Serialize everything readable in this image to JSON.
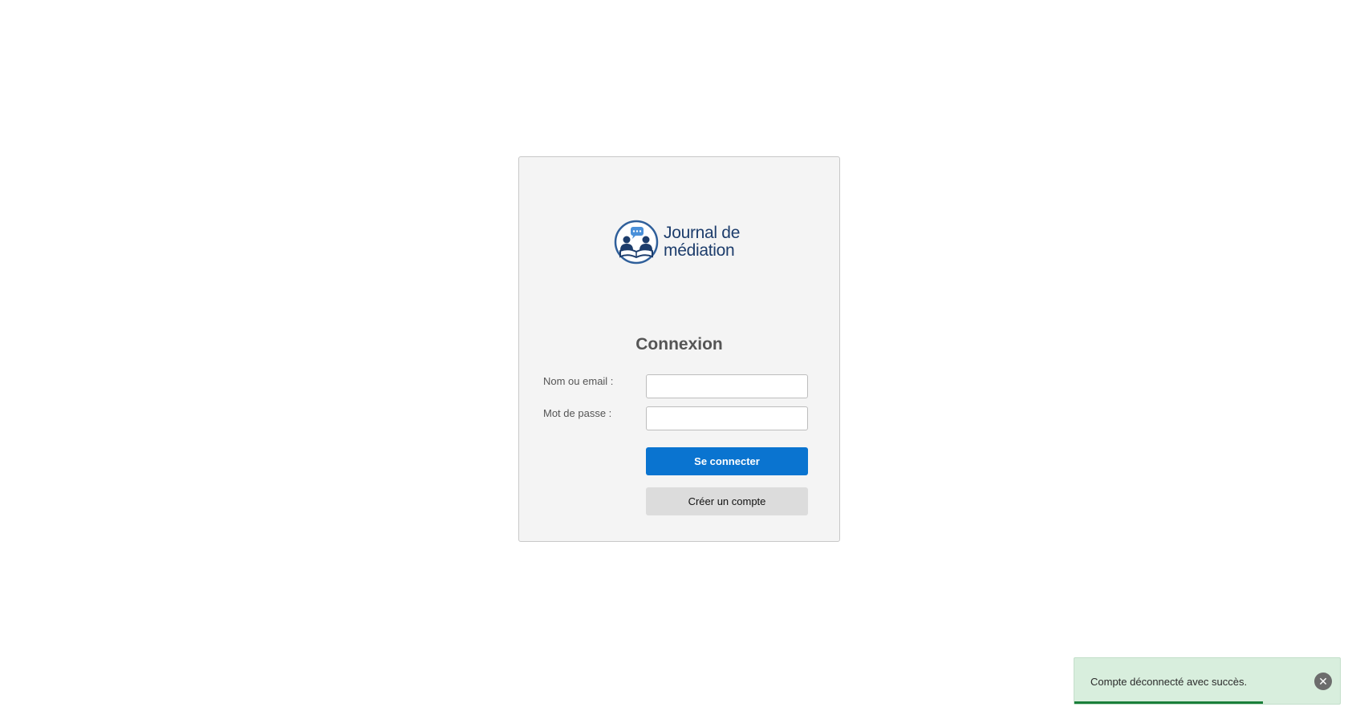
{
  "logo": {
    "line1": "Journal de",
    "line2": "médiation",
    "colors": {
      "text": "#1d3d6c",
      "accent": "#4a90d9"
    }
  },
  "login": {
    "title": "Connexion",
    "name_label": "Nom ou email :",
    "name_value": "",
    "password_label": "Mot de passe :",
    "password_value": "",
    "submit_label": "Se connecter",
    "create_label": "Créer un compte"
  },
  "toast": {
    "message": "Compte déconnecté avec succès.",
    "close_icon": "close-circle-icon",
    "progress_fraction": 0.71
  },
  "colors": {
    "primary_button": "#0a74d0",
    "secondary_button": "#dcdcdc",
    "toast_bg": "#d8eedd",
    "toast_progress": "#1a7f3a"
  }
}
